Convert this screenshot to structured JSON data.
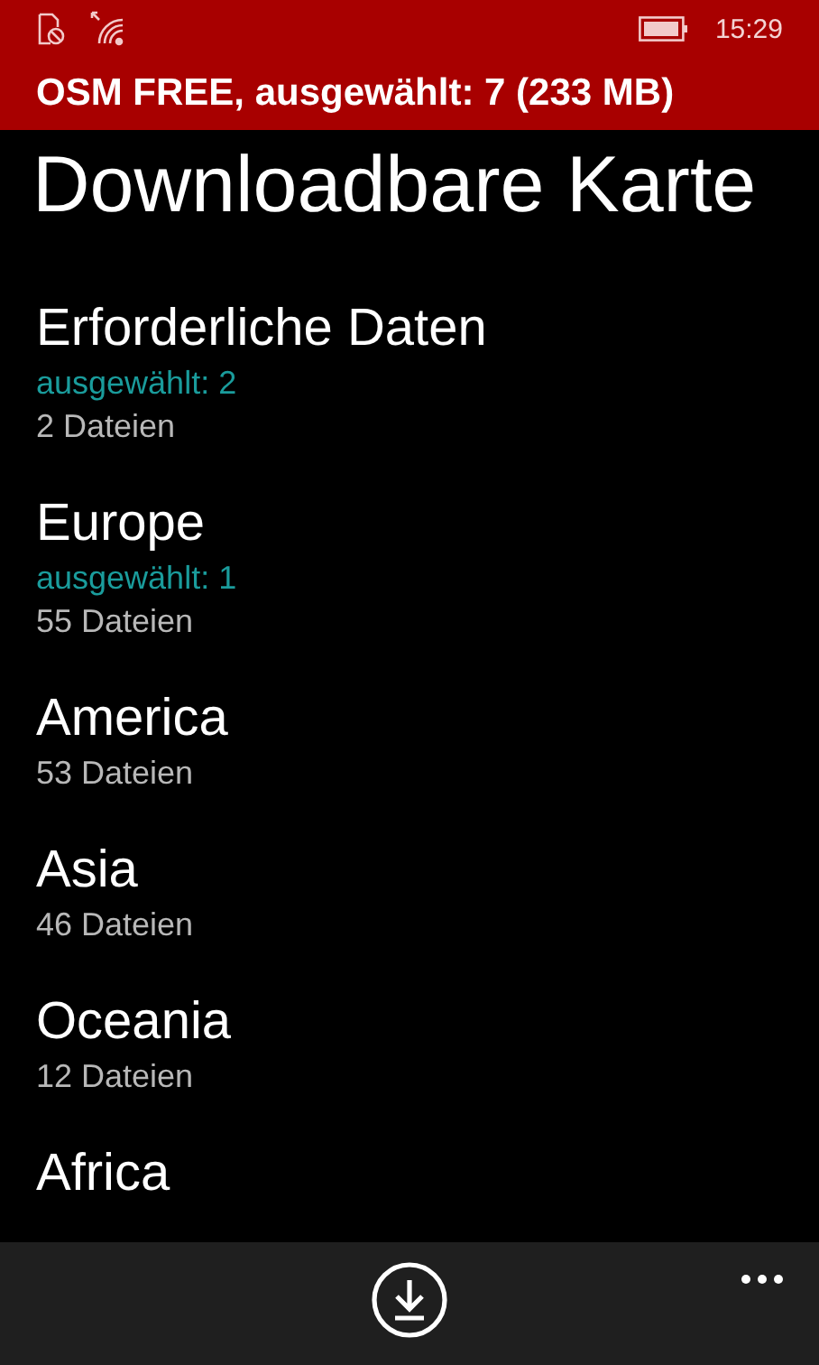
{
  "status_bar": {
    "time": "15:29"
  },
  "header": {
    "title": "OSM FREE, ausgewählt: 7 (233 MB)"
  },
  "page_title": "Downloadbare Karte",
  "groups": [
    {
      "name": "Erforderliche Daten",
      "selected_info": "ausgewählt: 2",
      "count": "2 Dateien"
    },
    {
      "name": "Europe",
      "selected_info": "ausgewählt: 1",
      "count": "55 Dateien"
    },
    {
      "name": "America",
      "count": "53 Dateien"
    },
    {
      "name": "Asia",
      "count": "46 Dateien"
    },
    {
      "name": "Oceania",
      "count": "12 Dateien"
    },
    {
      "name": "Africa"
    }
  ]
}
